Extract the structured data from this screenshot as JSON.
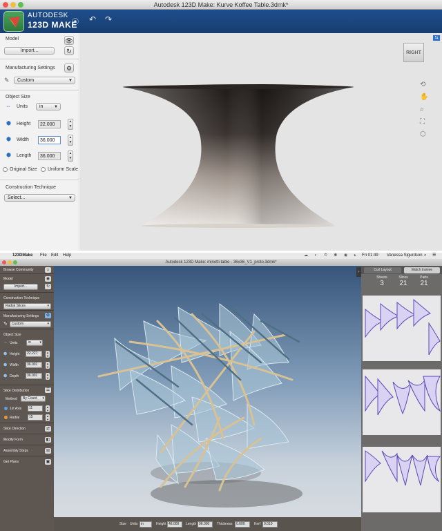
{
  "top_app": {
    "window_title": "Autodesk 123D Make: Kurve Koffee Table.3dmk*",
    "brand_line1": "AUTODESK",
    "brand_line2": "123D MAKE",
    "model": {
      "label": "Model",
      "import_button": "Import..."
    },
    "manufacturing": {
      "label": "Manufacturing Settings",
      "preset": "Custom"
    },
    "object_size": {
      "label": "Object Size",
      "units_label": "Units",
      "units_value": "in",
      "height_label": "Height",
      "height_value": "22.000",
      "width_label": "Width",
      "width_value": "36.000",
      "length_label": "Length",
      "length_value": "36.000",
      "original_size": "Original Size",
      "uniform_scale": "Uniform Scale"
    },
    "construction": {
      "label": "Construction Technique",
      "value": "Select..."
    },
    "viewcube_label": "RIGHT",
    "colors": {
      "title_bar_blue": "#1f4e8c",
      "logo_green": "#3f9a4f",
      "sidebar_bg": "#f2f2f2",
      "viewport_bg": "#e4e4e4"
    }
  },
  "bottom_app": {
    "menu": {
      "app": "123DMake",
      "file": "File",
      "edit": "Edit",
      "help": "Help",
      "clock": "Fri 01:49",
      "user": "Vanessa Sigurdson"
    },
    "window_title": "Autodesk 123D Make: minotti table - 36x36_V1_proto.3dmk*",
    "sidebar": {
      "browse_community": "Browse Community",
      "model_label": "Model",
      "import_button": "Import...",
      "construction_label": "Construction Technique",
      "construction_value": "Radial Slices",
      "manufacturing_label": "Manufacturing Settings",
      "manufacturing_value": "Custom",
      "object_size_label": "Object Size",
      "units_label": "Units",
      "units_value": "in",
      "height_label": "Height",
      "height_value": "22.227",
      "width_label": "Width",
      "width_value": "36.001",
      "depth_label": "Depth",
      "depth_value": "36.001",
      "slice_distribution_label": "Slice Distribution",
      "method_label": "Method",
      "method_value": "By Count",
      "axis_label": "1st Axis",
      "axis_value": "11",
      "radial_label": "Radial",
      "radial_value": "15",
      "slice_direction": "Slice Direction",
      "modify_form": "Modify Form",
      "assembly_steps": "Assembly Steps",
      "get_plans": "Get Plans"
    },
    "statusbar": {
      "size_label": "Size",
      "units_label": "Units",
      "units_value": "in",
      "height_label": "Height",
      "height_value": "48.000",
      "length_label": "Length",
      "length_value": "96.000",
      "thickness_label": "Thickness",
      "thickness_value": "0.600",
      "kerf_label": "Kerf",
      "kerf_value": "0.010"
    },
    "right_panel": {
      "tab_active": "Curl Layout",
      "tab_inactive": "Match trainee",
      "sheets_label": "Sheets",
      "sheets_value": "3",
      "slices_label": "Slices",
      "slices_value": "21",
      "parts_label": "Parts",
      "parts_value": "21"
    },
    "colors": {
      "sidebar_bg": "#5e5751",
      "viewport_top": "#36557a",
      "viewport_bottom": "#d6dbe0",
      "slice_glass": "#a9c4d6",
      "slice_wood": "#d8c294",
      "parts_purple": "#7a62c8"
    }
  }
}
